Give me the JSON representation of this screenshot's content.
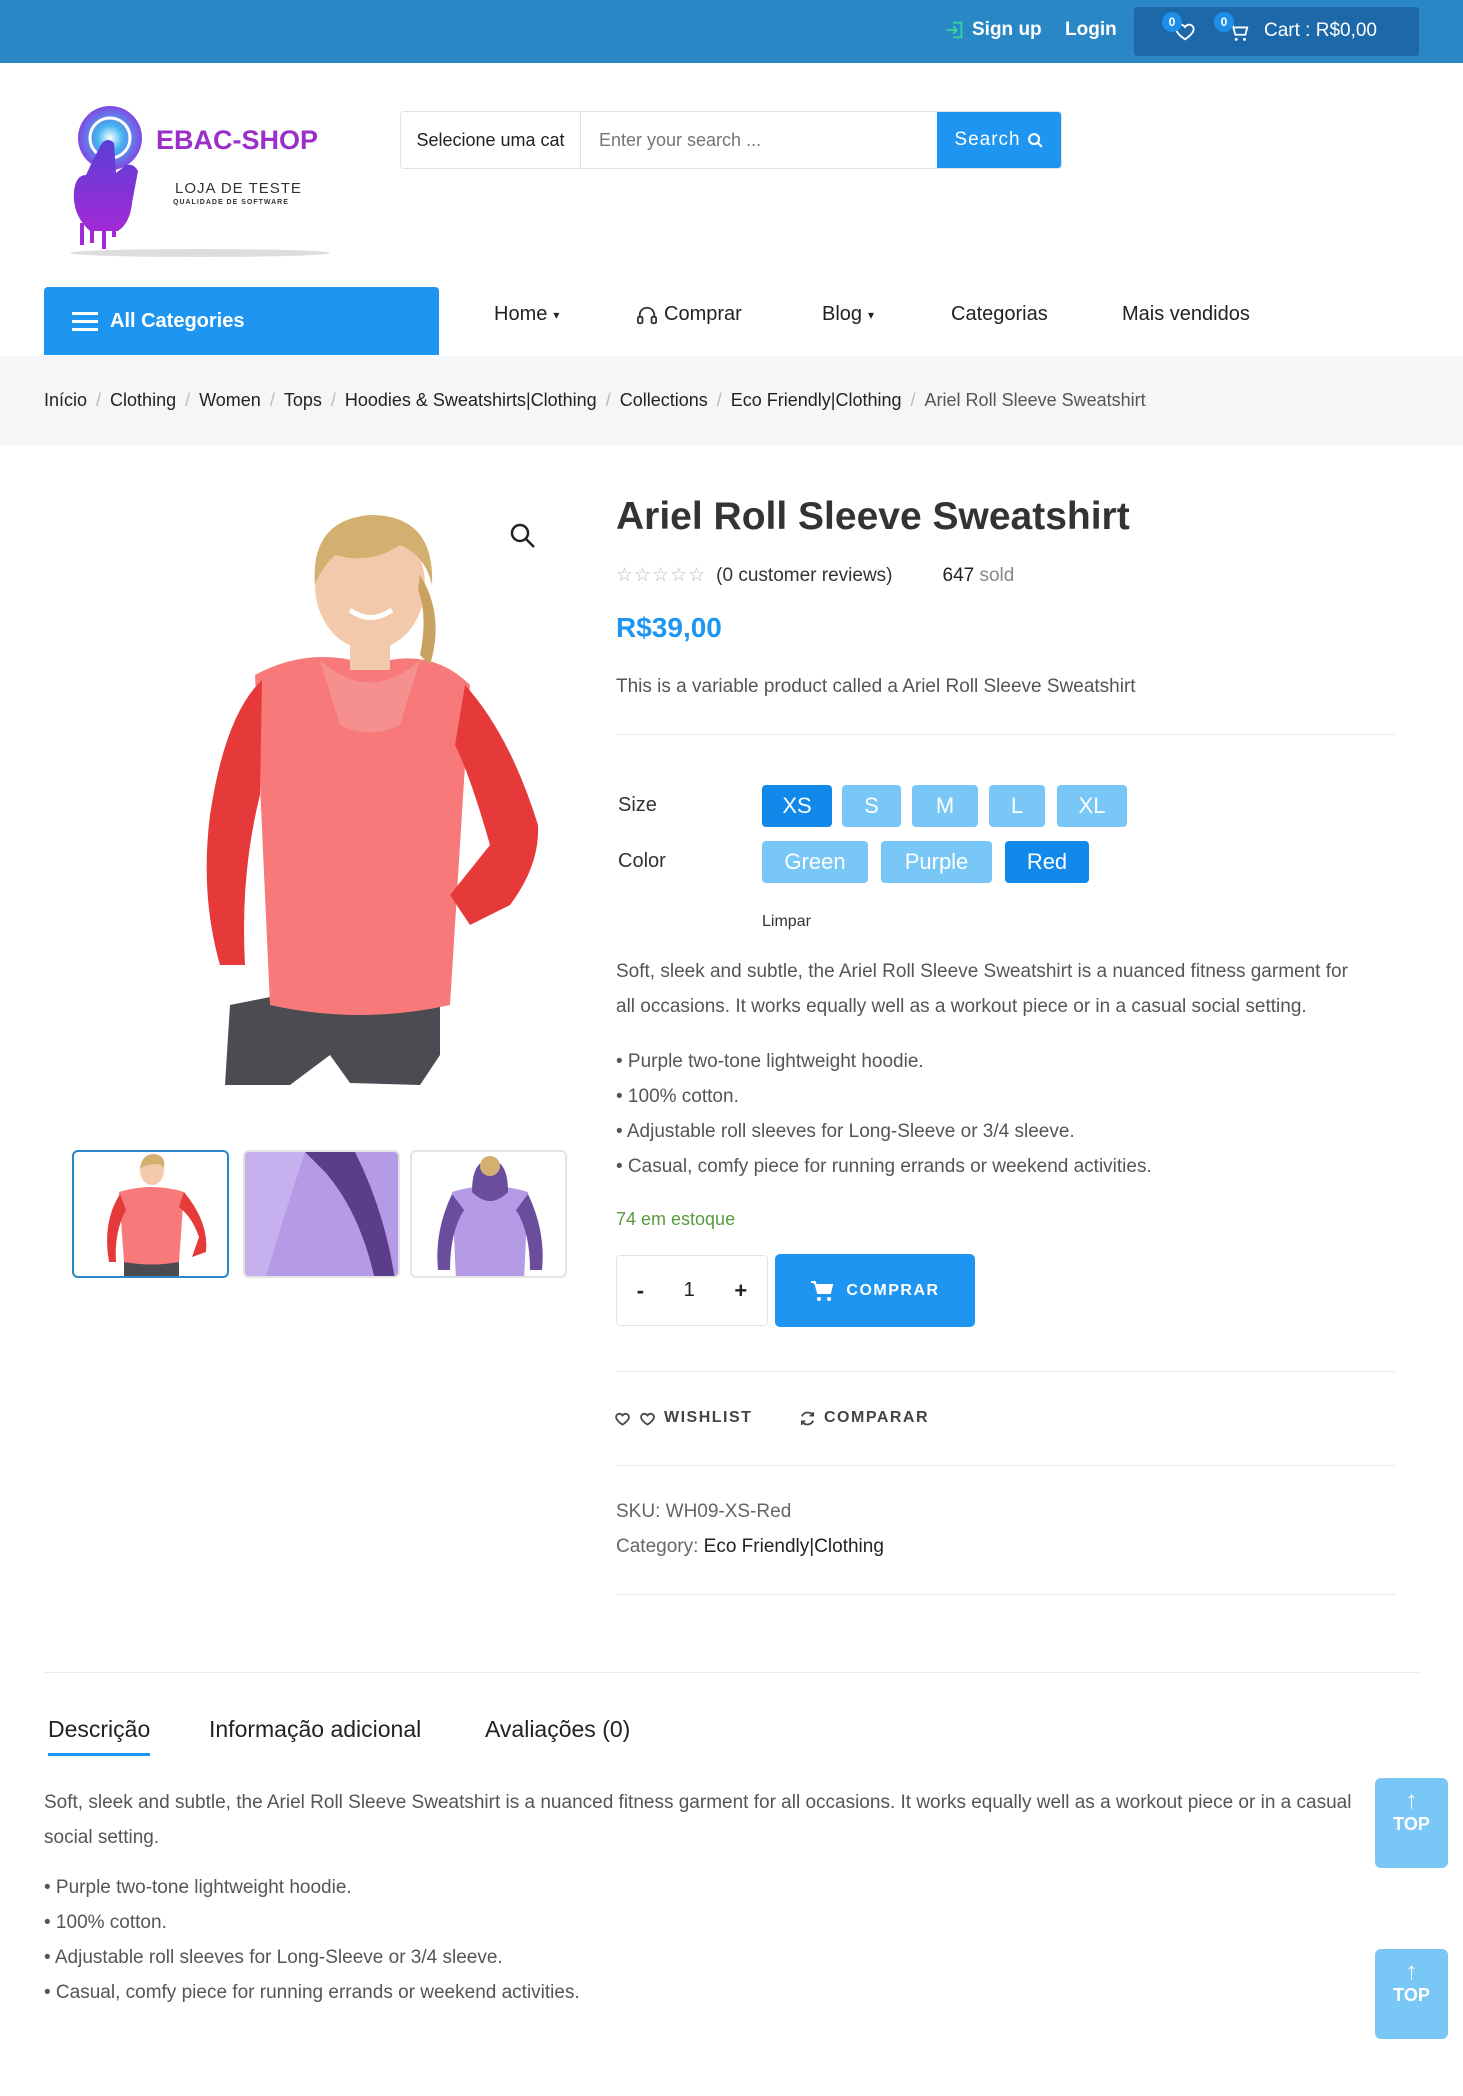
{
  "topbar": {
    "signup": "Sign up",
    "login": "Login",
    "wishlist_count": "0",
    "cart_count": "0",
    "cart_label": "Cart : R$0,00"
  },
  "logo": {
    "brand": "EBAC-SHOP",
    "tagline": "LOJA DE TESTE",
    "sub": "QUALIDADE DE SOFTWARE"
  },
  "search": {
    "category": "Selecione uma cat",
    "placeholder": "Enter your search ...",
    "button": "Search"
  },
  "nav": {
    "all_categories": "All Categories",
    "items": [
      "Home",
      "Comprar",
      "Blog",
      "Categorias",
      "Mais vendidos"
    ]
  },
  "breadcrumb": [
    "Início",
    "Clothing",
    "Women",
    "Tops",
    "Hoodies & Sweatshirts|Clothing",
    "Collections",
    "Eco Friendly|Clothing",
    "Ariel Roll Sleeve Sweatshirt"
  ],
  "product": {
    "title": "Ariel Roll Sleeve Sweatshirt",
    "stars": "☆☆☆☆☆",
    "reviews": "(0 customer reviews)",
    "sold_count": "647",
    "sold_label": "sold",
    "price": "R$39,00",
    "short_desc": "This is a variable product called a Ariel Roll Sleeve Sweatshirt",
    "size_label": "Size",
    "sizes": [
      "XS",
      "S",
      "M",
      "L",
      "XL"
    ],
    "selected_size": "XS",
    "color_label": "Color",
    "colors": [
      "Green",
      "Purple",
      "Red"
    ],
    "selected_color": "Red",
    "clear": "Limpar",
    "desc_line1": "Soft, sleek and subtle, the Ariel Roll Sleeve Sweatshirt is a nuanced fitness garment for",
    "desc_line2": "all occasions. It works equally well as a workout piece or in a casual social setting.",
    "bullets": [
      "• Purple two-tone lightweight hoodie.",
      "• 100% cotton.",
      "• Adjustable roll sleeves for Long-Sleeve or 3/4 sleeve.",
      "• Casual, comfy piece for running errands or weekend activities."
    ],
    "stock": "74 em estoque",
    "quantity": "1",
    "minus": "-",
    "plus": "+",
    "buy": "COMPRAR",
    "wishlist": "WISHLIST",
    "compare": "COMPARAR",
    "sku_label": "SKU:",
    "sku": "WH09-XS-Red",
    "category_label": "Category:",
    "category": "Eco Friendly|Clothing"
  },
  "tabs": [
    "Descrição",
    "Informação adicional",
    "Avaliações (0)"
  ],
  "long_desc": {
    "line1": "Soft, sleek and subtle, the Ariel Roll Sleeve Sweatshirt is a nuanced fitness garment for all occasions. It works equally well as a workout piece or in a casual",
    "line2": "social setting.",
    "bullets": [
      "• Purple two-tone lightweight hoodie.",
      "• 100% cotton.",
      "• Adjustable roll sleeves for Long-Sleeve or 3/4 sleeve.",
      "• Casual, comfy piece for running errands or weekend activities."
    ]
  },
  "top_button": "TOP",
  "colors": {
    "topbar": "#2a87c6",
    "accent": "#1e95f0",
    "option": "#79c7f6",
    "option_selected": "#1189ea",
    "stock": "#5a9a3e"
  }
}
